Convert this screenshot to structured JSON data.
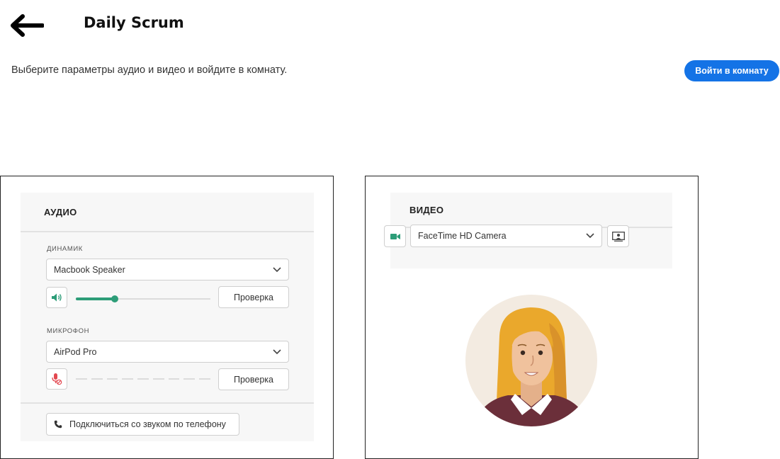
{
  "header": {
    "title": "Daily Scrum",
    "back_icon": "arrow-left-icon"
  },
  "intro": {
    "text": "Выберите параметры аудио и видео и войдите в комнату.",
    "join_label": "Войти в комнату",
    "join_color": "#1473e6"
  },
  "audio": {
    "heading": "АУДИО",
    "speaker": {
      "label": "ДИНАМИК",
      "selected": "Macbook Speaker",
      "volume_fraction": 0.29,
      "test_label": "Проверка"
    },
    "microphone": {
      "label": "МИКРОФОН",
      "selected": "AirPod Pro",
      "muted": true,
      "test_label": "Проверка"
    },
    "phone_label": "Подключиться со звуком по телефону"
  },
  "video": {
    "heading": "ВИДЕО",
    "camera_selected": "FaceTime HD Camera",
    "camera_on": true
  },
  "colors": {
    "accent_green": "#2d9d78",
    "mute_red": "#e34850",
    "card_bg": "#f7f7f7"
  }
}
